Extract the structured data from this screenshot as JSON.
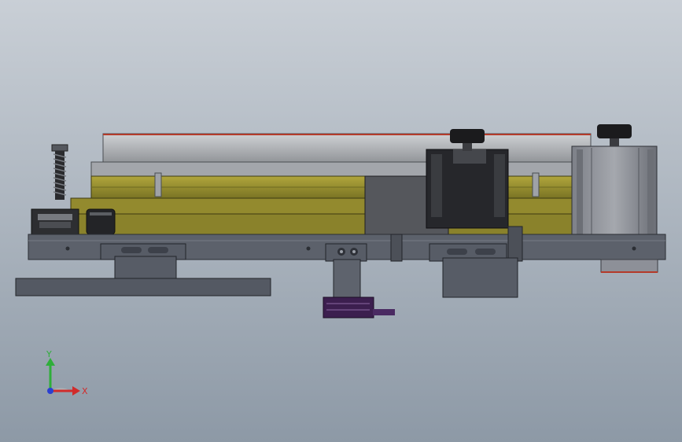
{
  "viewport": {
    "background_top": "#c9cfd6",
    "background_bottom": "#8d99a6"
  },
  "model": {
    "colors": {
      "steel": "#5f6470",
      "steel_dark": "#3f434c",
      "steel_light": "#8c919b",
      "brass": "#9c9330",
      "brass_dark": "#6d6820",
      "silver": "#b9bcc1",
      "silver_dark": "#8f9296",
      "red_trim": "#b43a2a",
      "black": "#1e1f22",
      "purple": "#3c1f4f"
    },
    "motors": 2,
    "knobs": 2
  },
  "triad": {
    "x_label": "X",
    "y_label": "Y",
    "x_color": "#d12b2b",
    "y_color": "#2fae3a",
    "z_color": "#2b3fd1"
  }
}
